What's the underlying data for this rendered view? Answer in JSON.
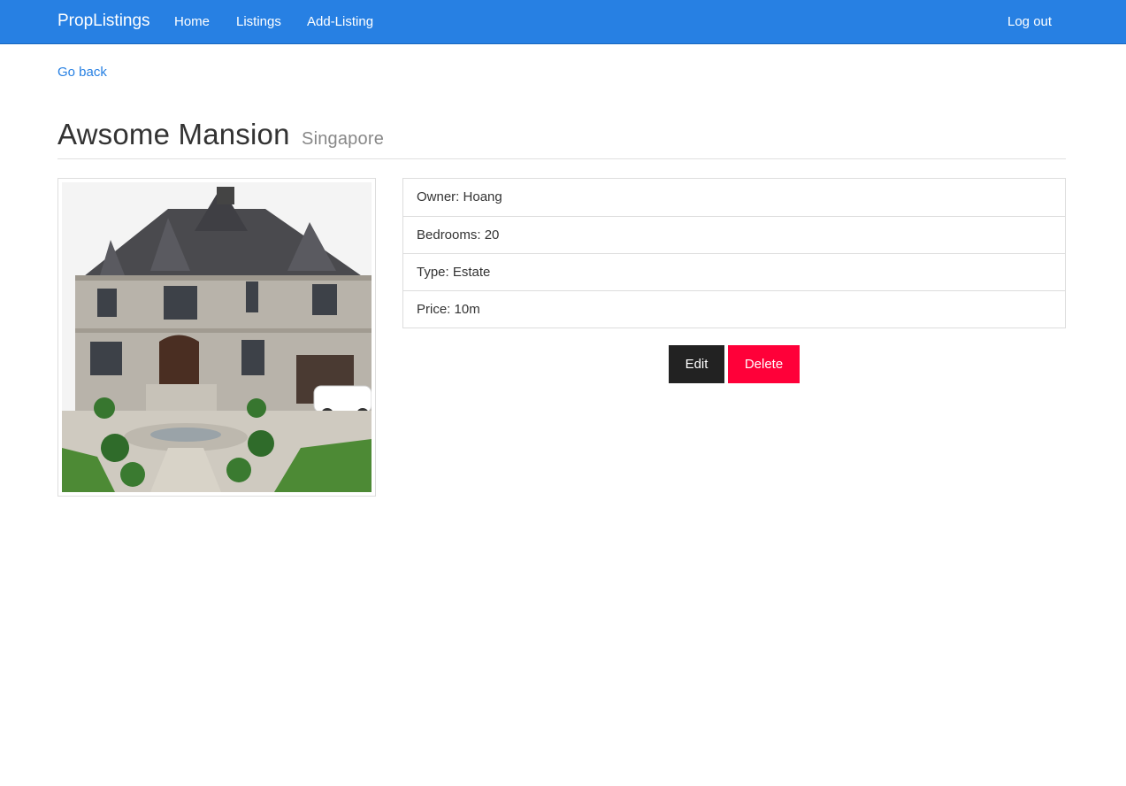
{
  "navbar": {
    "brand": "PropListings",
    "links": [
      "Home",
      "Listings",
      "Add-Listing"
    ],
    "logout": "Log out"
  },
  "page": {
    "back_link": "Go back",
    "title": "Awsome Mansion",
    "subtitle": "Singapore"
  },
  "details": [
    "Owner: Hoang",
    "Bedrooms: 20",
    "Type: Estate",
    "Price: 10m"
  ],
  "actions": {
    "edit": "Edit",
    "delete": "Delete"
  },
  "colors": {
    "navbar": "#2780e3",
    "link": "#2780e3",
    "edit_button": "#222222",
    "delete_button": "#ff0039"
  }
}
